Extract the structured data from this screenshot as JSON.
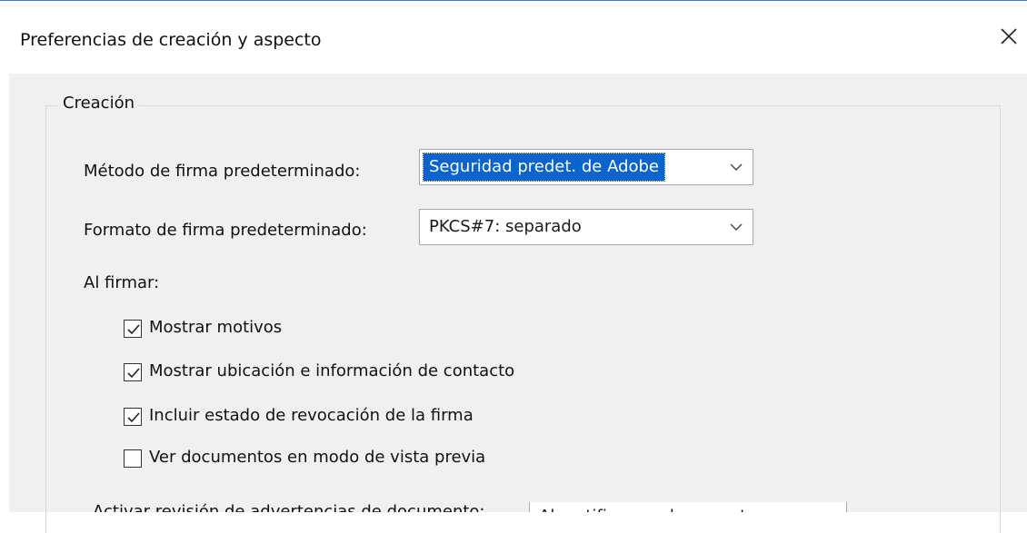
{
  "window": {
    "title": "Preferencias de creación y aspecto",
    "close_icon": "close-icon"
  },
  "group": {
    "legend": "Creación"
  },
  "default_method": {
    "label": "Método de firma predeterminado:",
    "value": "Seguridad predet. de Adobe"
  },
  "default_format": {
    "label": "Formato de firma predeterminado:",
    "value": "PKCS#7: separado"
  },
  "on_signing": {
    "label": "Al firmar:",
    "options": [
      {
        "label": "Mostrar motivos",
        "checked": true
      },
      {
        "label": "Mostrar ubicación e información de contacto",
        "checked": true
      },
      {
        "label": "Incluir estado de revocación de la firma",
        "checked": true
      },
      {
        "label": "Ver documentos en modo de vista previa",
        "checked": false
      }
    ]
  },
  "doc_warnings": {
    "label": "Activar revisión de advertencias de documento:",
    "value": "Al certificar un documento"
  },
  "colors": {
    "selection": "#0a64cf",
    "dialog_bg": "#f0f0f0",
    "title_border": "#3c7fd8"
  }
}
